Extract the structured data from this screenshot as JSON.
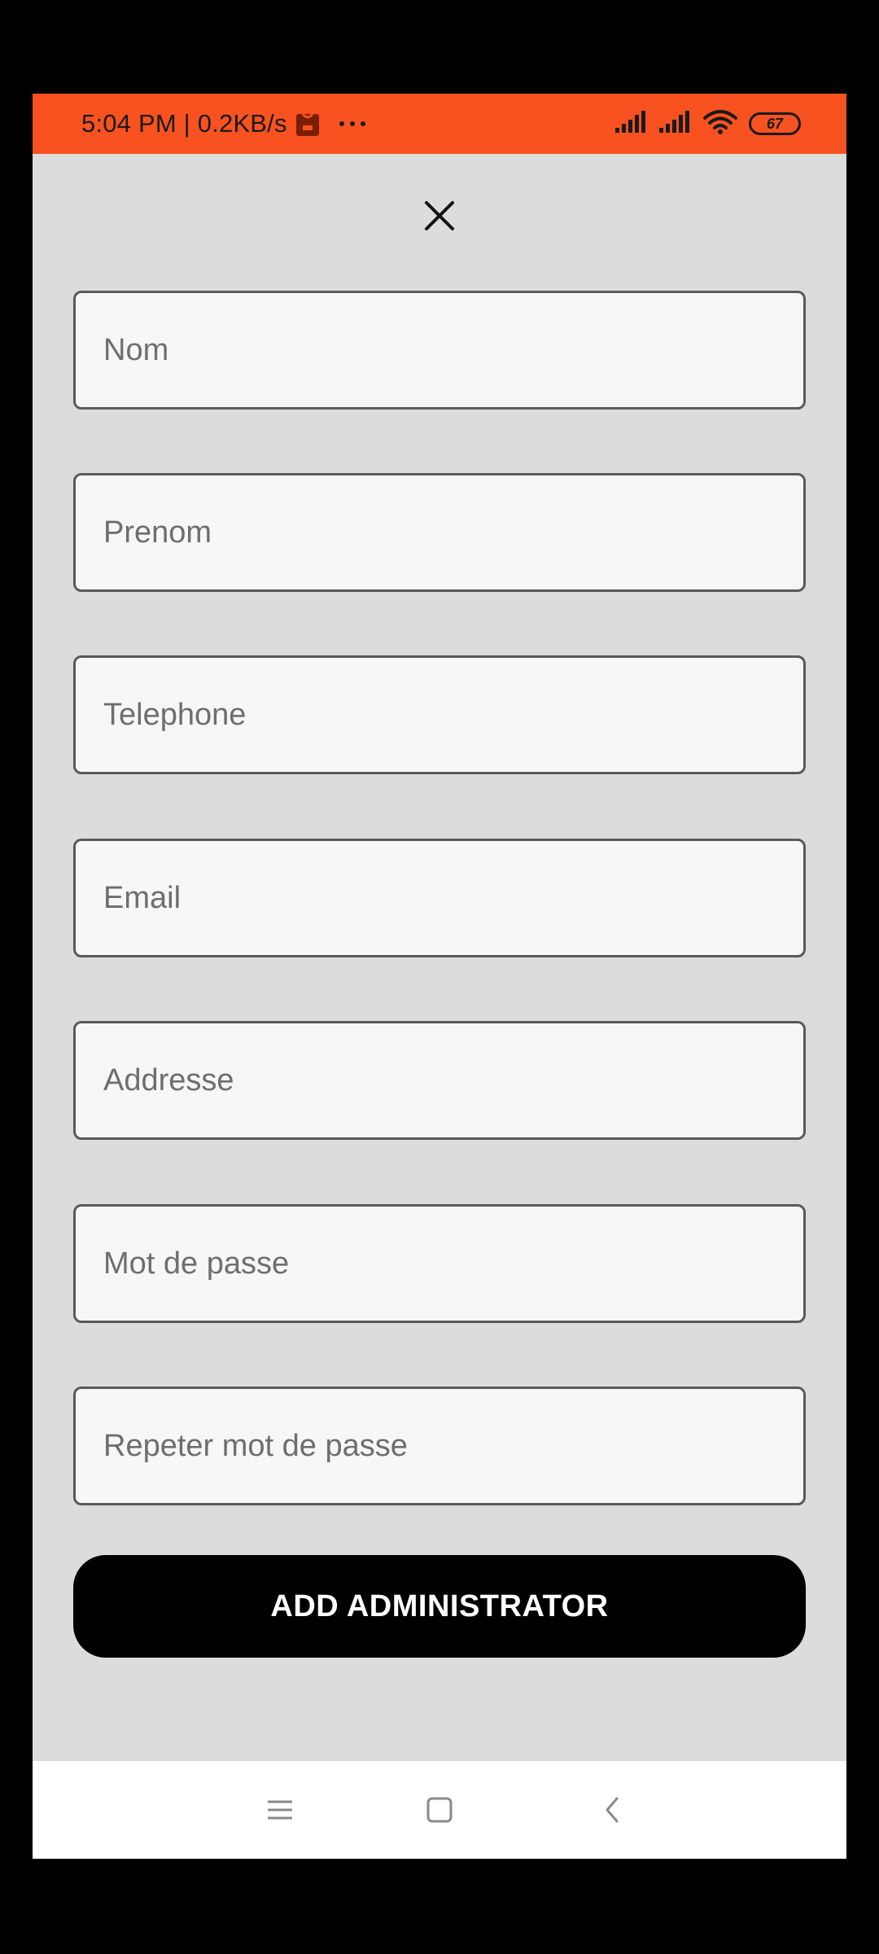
{
  "status_bar": {
    "time_speed": "5:04 PM | 0.2KB/s",
    "battery_level": "67",
    "background_color": "#f7521f"
  },
  "form": {
    "fields": [
      {
        "placeholder": "Nom",
        "type": "text"
      },
      {
        "placeholder": "Prenom",
        "type": "text"
      },
      {
        "placeholder": "Telephone",
        "type": "tel"
      },
      {
        "placeholder": "Email",
        "type": "email"
      },
      {
        "placeholder": "Addresse",
        "type": "text"
      },
      {
        "placeholder": "Mot de passe",
        "type": "password"
      },
      {
        "placeholder": "Repeter mot de passe",
        "type": "password"
      }
    ],
    "submit_label": "ADD ADMINISTRATOR"
  },
  "icons": {
    "close": "close-icon",
    "menu": "menu-icon",
    "home": "home-icon",
    "back": "back-icon"
  },
  "colors": {
    "screen_background": "#dcdcdc",
    "field_background": "#f7f7f7",
    "button_background": "#000000",
    "button_text": "#ffffff"
  }
}
